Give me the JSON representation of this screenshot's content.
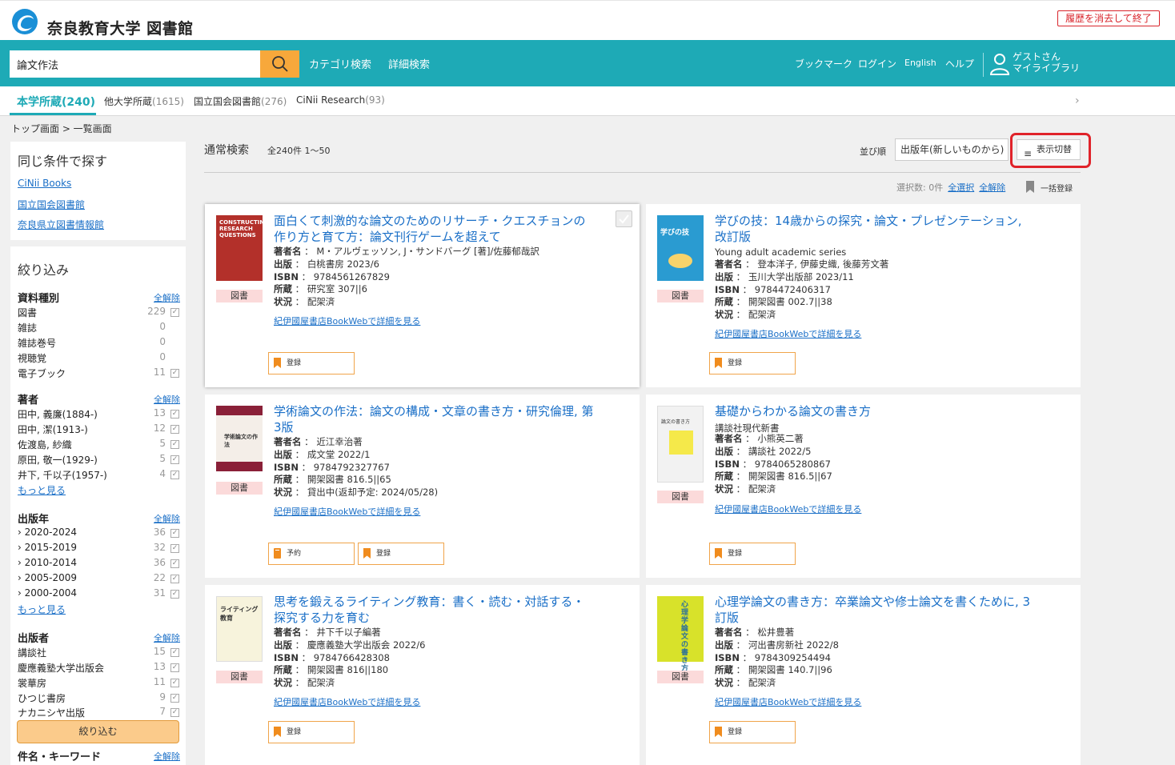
{
  "header": {
    "site_title": "奈良教育大学 図書館",
    "logout": "履歴を消去して終了"
  },
  "search": {
    "value": "論文作法",
    "category": "カテゴリ検索",
    "advanced": "詳細検索"
  },
  "nav": {
    "bookmark": "ブックマーク",
    "login": "ログイン",
    "english": "English",
    "help": "ヘルプ",
    "guest": "ゲストさん",
    "mylibrary": "マイライブラリ"
  },
  "tabs": [
    {
      "label": "本学所蔵",
      "count": "(240)"
    },
    {
      "label": "他大学所蔵",
      "count": "(1615)"
    },
    {
      "label": "国立国会図書館",
      "count": "(276)"
    },
    {
      "label": "CiNii Research",
      "count": "(93)"
    }
  ],
  "breadcrumb": "トップ画面 > 一覧画面",
  "same": {
    "title": "同じ条件で探す",
    "links": [
      "CiNii Books",
      "国立国会図書館",
      "奈良県立図書情報館"
    ]
  },
  "refine": {
    "title": "絞り込み",
    "clear": "全解除",
    "more": "もっと見る",
    "button": "絞り込む",
    "facets": [
      {
        "title": "資料種別",
        "items": [
          {
            "label": "図書",
            "count": "229"
          },
          {
            "label": "雑誌",
            "count": "0"
          },
          {
            "label": "雑誌巻号",
            "count": "0"
          },
          {
            "label": "視聴覚",
            "count": "0"
          },
          {
            "label": "電子ブック",
            "count": "11"
          }
        ]
      },
      {
        "title": "著者",
        "items": [
          {
            "label": "田中, 義廉(1884-)",
            "count": "13"
          },
          {
            "label": "田中, 潔(1913-)",
            "count": "12"
          },
          {
            "label": "佐渡島, 紗織",
            "count": "5"
          },
          {
            "label": "原田, 敬一(1929-)",
            "count": "5"
          },
          {
            "label": "井下, 千以子(1957-)",
            "count": "4"
          }
        ]
      },
      {
        "title": "出版年",
        "items": [
          {
            "label": "2020-2024",
            "count": "36"
          },
          {
            "label": "2015-2019",
            "count": "32"
          },
          {
            "label": "2010-2014",
            "count": "36"
          },
          {
            "label": "2005-2009",
            "count": "22"
          },
          {
            "label": "2000-2004",
            "count": "31"
          }
        ]
      },
      {
        "title": "出版者",
        "items": [
          {
            "label": "講談社",
            "count": "15"
          },
          {
            "label": "慶應義塾大学出版会",
            "count": "13"
          },
          {
            "label": "裳華房",
            "count": "11"
          },
          {
            "label": "ひつじ書房",
            "count": "9"
          },
          {
            "label": "ナカニシヤ出版",
            "count": "7"
          }
        ]
      },
      {
        "title": "件名・キーワード",
        "items": []
      }
    ]
  },
  "results": {
    "title": "通常検索",
    "count": "全240件 1～50",
    "sort_label": "並び順",
    "sort_value": "出版年(新しいものから)",
    "display_toggle": "表示切替",
    "selection": "選択数: 0件",
    "select_all": "全選択",
    "clear_all": "全解除",
    "bulk": "一括登録"
  },
  "labels": {
    "author": "著者名",
    "publisher": "出版",
    "isbn": "ISBN",
    "holding": "所蔵",
    "status": "状況",
    "sep": "：",
    "kino": "紀伊國屋書店BookWebで詳細を見る",
    "register": "登録",
    "reserve": "予約"
  },
  "books": [
    {
      "title": "面白くて刺激的な論文のためのリサーチ・クエスチョンの作り方と育て方：論文刊行ゲームを超えて",
      "series": "",
      "author": "M・アルヴェッソン, J・サンドバーグ [著]/佐藤郁哉訳",
      "publisher": "白桃書房 2023/6",
      "isbn": "9784561267829",
      "holding": "研究室 307||6",
      "status": "配架済",
      "type": "図書",
      "cover_text": "CONSTRUCTING RESEARCH QUESTIONS",
      "cover_color": "#b3302a"
    },
    {
      "title": "学びの技：14歳からの探究・論文・プレゼンテーション, 改訂版",
      "series": "Young adult academic series",
      "author": "登本洋子, 伊藤史織, 後藤芳文著",
      "publisher": "玉川大学出版部 2023/11",
      "isbn": "9784472406317",
      "holding": "開架図書 002.7||38",
      "status": "配架済",
      "type": "図書",
      "cover_text": "学びの技",
      "cover_color": "#2a9bd1"
    },
    {
      "title": "学術論文の作法：論文の構成・文章の書き方・研究倫理, 第3版",
      "series": "",
      "author": "近江幸治著",
      "publisher": "成文堂 2022/1",
      "isbn": "9784792327767",
      "holding": "開架図書 816.5||65",
      "status": "貸出中(返却予定: 2024/05/28)",
      "type": "図書",
      "cover_text": "学術論文の作法",
      "cover_color": "#8a2038"
    },
    {
      "title": "基礎からわかる論文の書き方",
      "series": "講談社現代新書",
      "author": "小熊英二著",
      "publisher": "講談社 2022/5",
      "isbn": "9784065280867",
      "holding": "開架図書 816.5||67",
      "status": "配架済",
      "type": "図書",
      "cover_text": "論文の書き方",
      "cover_color": "#f2f2f2"
    },
    {
      "title": "思考を鍛えるライティング教育：書く・読む・対話する・探究する力を育む",
      "series": "",
      "author": "井下千以子編著",
      "publisher": "慶應義塾大学出版会 2022/6",
      "isbn": "9784766428308",
      "holding": "開架図書 816||180",
      "status": "配架済",
      "type": "図書",
      "cover_text": "ライティング教育",
      "cover_color": "#f7f3dc"
    },
    {
      "title": "心理学論文の書き方：卒業論文や修士論文を書くために, 3訂版",
      "series": "",
      "author": "松井豊著",
      "publisher": "河出書房新社 2022/8",
      "isbn": "9784309254494",
      "holding": "開架図書 140.7||96",
      "status": "配架済",
      "type": "図書",
      "cover_text": "心理学論文の書き方",
      "cover_color": "#d8e22a"
    }
  ],
  "colors": {
    "accent": "#1eaab6",
    "search_button": "#f7a83b",
    "link": "#1a6fc7",
    "highlight": "#e0232a"
  }
}
